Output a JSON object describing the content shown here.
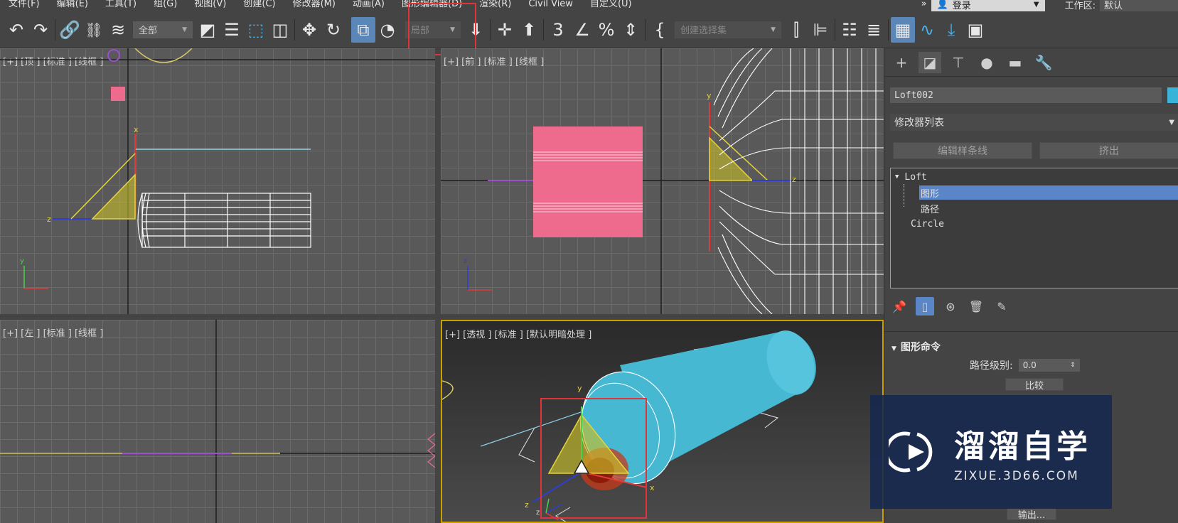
{
  "menubar": {
    "items": [
      "文件(F)",
      "编辑(E)",
      "工具(T)",
      "组(G)",
      "视图(V)",
      "创建(C)",
      "修改器(M)",
      "动画(A)",
      "图形编辑器(D)",
      "渲染(R)",
      "Civil View",
      "自定义(U)"
    ],
    "login": "登录",
    "workspace_label": "工作区:",
    "workspace_value": "默认"
  },
  "toolbar": {
    "filter_value": "全部",
    "coord_value": "局部",
    "selection_set_placeholder": "创建选择集"
  },
  "viewports": {
    "top_label": "[+] [顶 ] [标准 ] [线框 ]",
    "front_label": "[+] [前 ] [标准 ] [线框 ]",
    "left_label": "[+] [左 ] [标准 ] [线框 ]",
    "persp_label": "[+] [透视 ] [标准 ] [默认明暗处理 ]"
  },
  "command_panel": {
    "object_name": "Loft002",
    "modifier_list": "修改器列表",
    "buttons": {
      "edit_spline": "编辑样条线",
      "extrude": "挤出"
    },
    "stack": {
      "root": "Loft",
      "sub_shape": "图形",
      "sub_path": "路径",
      "base": "Circle"
    },
    "rollout_title": "图形命令",
    "path_level_label": "路径级别:",
    "path_level_value": "0.0",
    "compare_button": "比较",
    "output_button": "输出..."
  },
  "watermark": {
    "title": "溜溜自学",
    "subtitle": "ZIXUE.3D66.COM"
  },
  "colors": {
    "accent_blue": "#5a86c8",
    "highlight_red": "#e0343a",
    "cylinder": "#46b8d2",
    "rectangle_pink": "#ef6b8e"
  }
}
